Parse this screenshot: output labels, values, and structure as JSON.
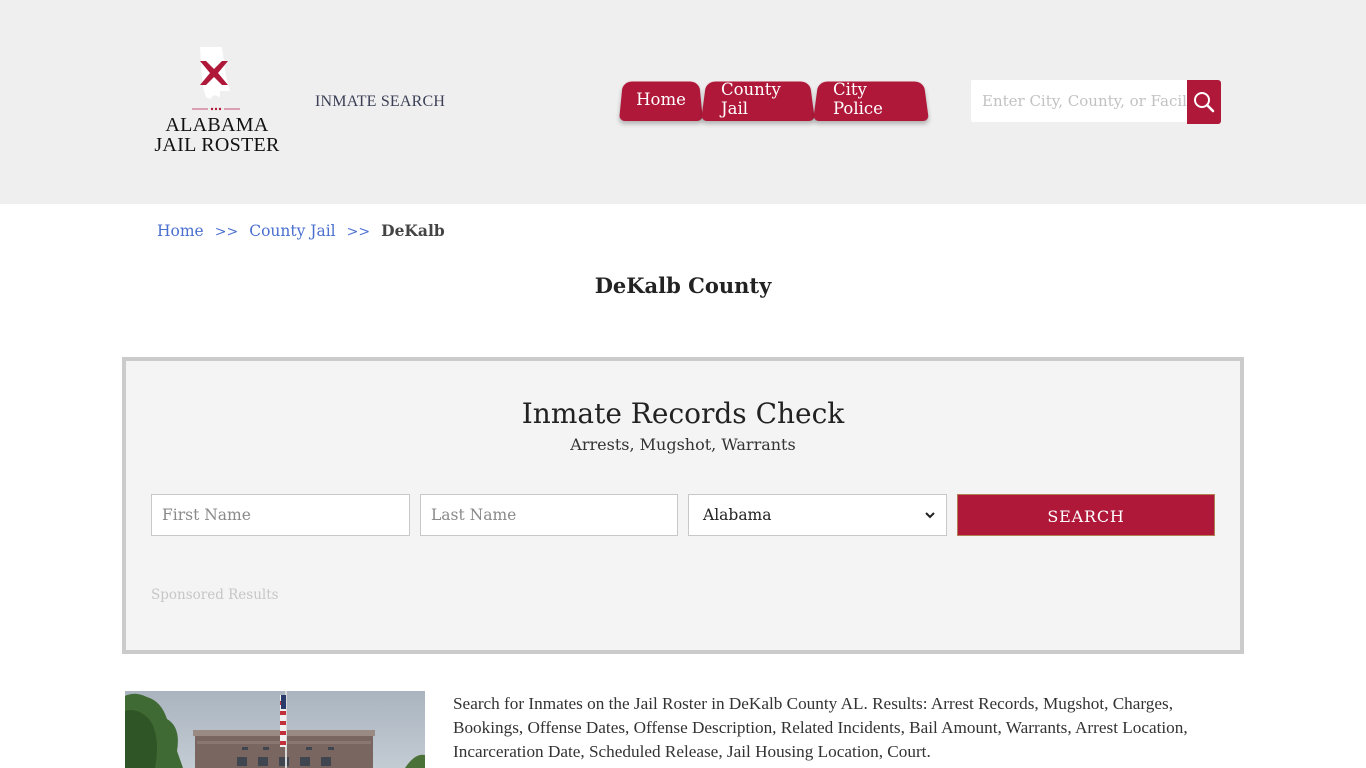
{
  "header": {
    "logo": {
      "line1": "ALABAMA",
      "line2": "JAIL ROSTER",
      "icon": "alabama-state-flag-icon"
    },
    "inmate_search_link": "INMATE SEARCH",
    "nav": [
      {
        "label": "Home"
      },
      {
        "label": "County Jail"
      },
      {
        "label": "City Police"
      }
    ],
    "site_search": {
      "placeholder": "Enter City, County, or Facility",
      "icon": "search-icon"
    }
  },
  "breadcrumb": {
    "items": [
      {
        "label": "Home"
      },
      {
        "label": "County Jail"
      }
    ],
    "separator": ">>",
    "current": "DeKalb"
  },
  "page_title": "DeKalb County",
  "records_check": {
    "title": "Inmate Records Check",
    "subtitle": "Arrests, Mugshot, Warrants",
    "first_name_placeholder": "First Name",
    "last_name_placeholder": "Last Name",
    "state_selected": "Alabama",
    "search_label": "SEARCH",
    "sponsored_label": "Sponsored Results"
  },
  "description": "Search for Inmates on the Jail Roster in DeKalb County AL. Results: Arrest Records, Mugshot, Charges, Bookings, Offense Dates, Offense Description, Related Incidents, Bail Amount, Warrants, Arrest Location, Incarceration Date, Scheduled Release, Jail Housing Location, Court.",
  "colors": {
    "brand": "#b0183a",
    "header_bg": "#efefef",
    "link": "#4a6fcf"
  }
}
